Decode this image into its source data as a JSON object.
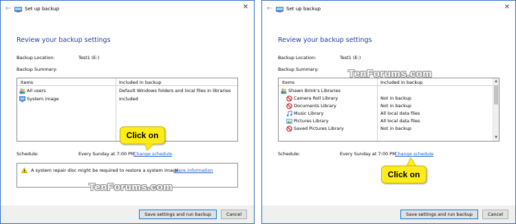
{
  "colors": {
    "accent": "#1a3e9f",
    "link": "#1a5fc8",
    "callout": "#ffec1a",
    "border": "#2d6fc2"
  },
  "window_title": "Set up backup",
  "heading": "Review your backup settings",
  "labels": {
    "backup_location": "Backup Location:",
    "backup_summary": "Backup Summary:",
    "schedule": "Schedule:"
  },
  "location_value": "Test1 (E:)",
  "schedule_value": "Every Sunday at 7:00 PM",
  "change_schedule": "Change schedule",
  "columns": {
    "items": "Items",
    "included": "Included in backup"
  },
  "left": {
    "rows": [
      {
        "icon": "users-icon",
        "item": "All users",
        "included": "Default Windows folders and local files in libraries"
      },
      {
        "icon": "monitor-icon",
        "item": "System image",
        "included": "Included"
      }
    ],
    "warning": "A system repair disc might be required to restore a system image.",
    "more_info": "More information"
  },
  "right": {
    "rows": [
      {
        "icon": "users-icon",
        "item": "Shawn Brink's Libraries",
        "included": ""
      },
      {
        "icon": "blocked-icon",
        "item": "Camera Roll Library",
        "included": "Not in backup"
      },
      {
        "icon": "blocked-icon",
        "item": "Documents Library",
        "included": "Not in backup"
      },
      {
        "icon": "music-icon",
        "item": "Music Library",
        "included": "All local data files"
      },
      {
        "icon": "pictures-icon",
        "item": "Pictures Library",
        "included": "All local data files"
      },
      {
        "icon": "blocked-icon",
        "item": "Saved Pictures Library",
        "included": "Not in backup"
      }
    ]
  },
  "buttons": {
    "save": "Save settings and run backup",
    "cancel": "Cancel"
  },
  "callout": "Click on",
  "watermark": "TenForums.com"
}
